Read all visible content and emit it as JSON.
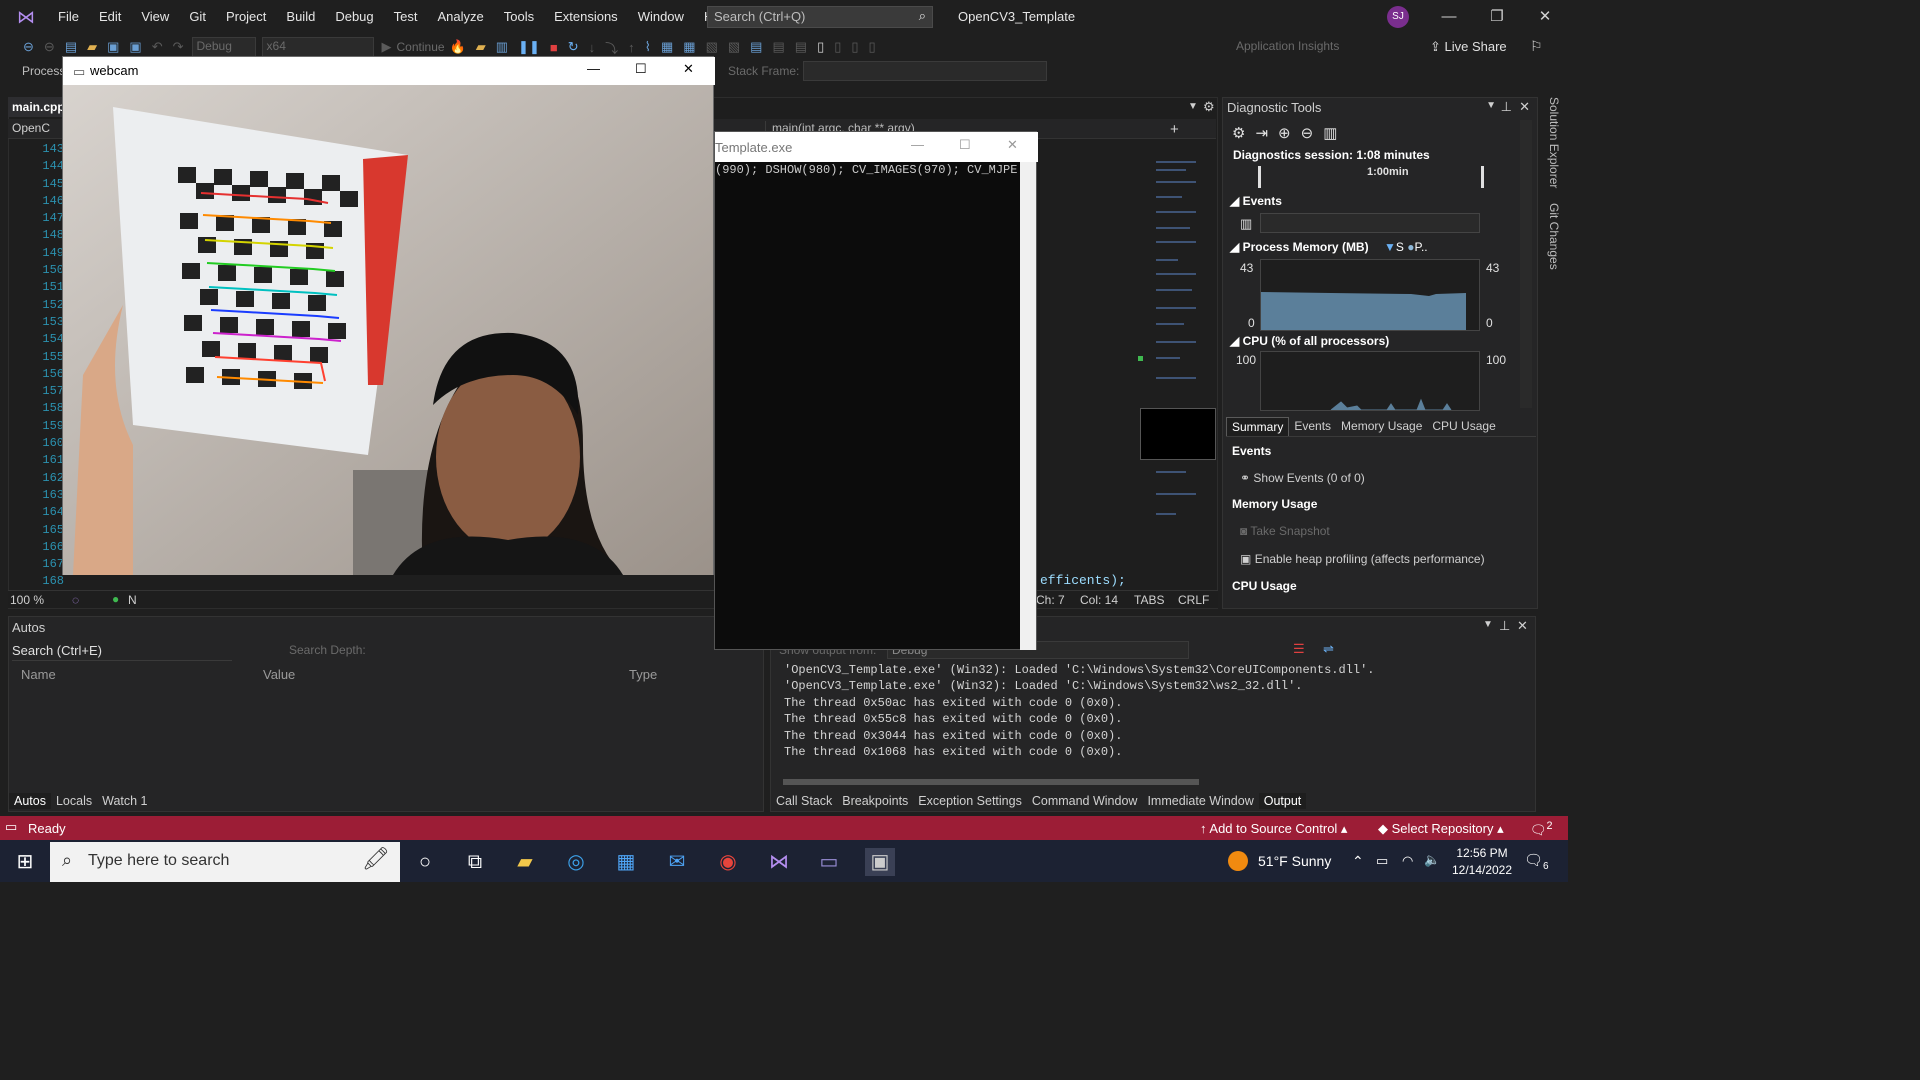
{
  "menubar": {
    "items": [
      "File",
      "Edit",
      "View",
      "Git",
      "Project",
      "Build",
      "Debug",
      "Test",
      "Analyze",
      "Tools",
      "Extensions",
      "Window",
      "Help"
    ],
    "search_placeholder": "Search (Ctrl+Q)",
    "solution_title": "OpenCV3_Template",
    "avatar_initials": "SJ"
  },
  "toolbar": {
    "config": "Debug",
    "platform": "x64",
    "continue": "Continue",
    "app_insights": "Application Insights",
    "live_share": "Live Share",
    "process_label": "Process:",
    "stack_frame_label": "Stack Frame:"
  },
  "editor": {
    "tab": "main.cpp",
    "project_nav": "OpenC",
    "func_nav": "main(int argc, char ** argv)",
    "lines": [
      "143",
      "144",
      "145",
      "146",
      "147",
      "148",
      "149",
      "150",
      "151",
      "152",
      "153",
      "154",
      "155",
      "156",
      "157",
      "158",
      "159",
      "160",
      "161",
      "162",
      "163",
      "164",
      "165",
      "166",
      "167",
      "168"
    ],
    "code_fragment": "efficents);",
    "zoom": "100 %",
    "status_prefix": "N",
    "ch": "Ch: 7",
    "col": "Col: 14",
    "tabs": "TABS",
    "crlf": "CRLF"
  },
  "webcam": {
    "title": "webcam"
  },
  "console": {
    "title": "Template.exe",
    "text": "(990); DSHOW(980); CV_IMAGES(970); CV_MJPE"
  },
  "diagnostics": {
    "title": "Diagnostic Tools",
    "session": "Diagnostics session: 1:08 minutes",
    "timeline_label": "1:00min",
    "events_label": "Events",
    "memory_label": "Process Memory (MB)",
    "memory_legend_s": "S",
    "memory_legend_p": "P..",
    "memory_max": "43",
    "memory_min": "0",
    "cpu_label": "CPU (% of all processors)",
    "cpu_max": "100",
    "tabs": [
      "Summary",
      "Events",
      "Memory Usage",
      "CPU Usage"
    ],
    "summary_events": "Events",
    "show_events": "Show Events (0 of 0)",
    "summary_memory": "Memory Usage",
    "take_snapshot": "Take Snapshot",
    "heap_profiling": "Enable heap profiling (affects performance)",
    "summary_cpu": "CPU Usage"
  },
  "side_panel": {
    "solution_explorer": "Solution Explorer",
    "git_changes": "Git Changes"
  },
  "autos": {
    "title": "Autos",
    "search_placeholder": "Search (Ctrl+E)",
    "search_depth": "Search Depth:",
    "columns": [
      "Name",
      "Value",
      "Type"
    ],
    "tabs": [
      "Autos",
      "Locals",
      "Watch 1"
    ]
  },
  "output": {
    "show_output_from": "Show output from:",
    "source": "Debug",
    "lines": [
      "'OpenCV3_Template.exe' (Win32): Loaded 'C:\\Windows\\System32\\CoreUIComponents.dll'.",
      "'OpenCV3_Template.exe' (Win32): Loaded 'C:\\Windows\\System32\\ws2_32.dll'.",
      "The thread 0x50ac has exited with code 0 (0x0).",
      "The thread 0x55c8 has exited with code 0 (0x0).",
      "The thread 0x3044 has exited with code 0 (0x0).",
      "The thread 0x1068 has exited with code 0 (0x0)."
    ],
    "tabs": [
      "Call Stack",
      "Breakpoints",
      "Exception Settings",
      "Command Window",
      "Immediate Window",
      "Output"
    ]
  },
  "statusbar": {
    "ready": "Ready",
    "add_source_control": "Add to Source Control",
    "select_repository": "Select Repository",
    "notifications": "2"
  },
  "taskbar": {
    "search_placeholder": "Type here to search",
    "weather_temp": "51°F",
    "weather_desc": "Sunny",
    "time": "12:56 PM",
    "date": "12/14/2022",
    "notif_count": "6"
  },
  "colors": {
    "status_bar": "#9c1d36",
    "vs_purple": "#b48ef0",
    "chart_fill": "#5b7f9a"
  }
}
